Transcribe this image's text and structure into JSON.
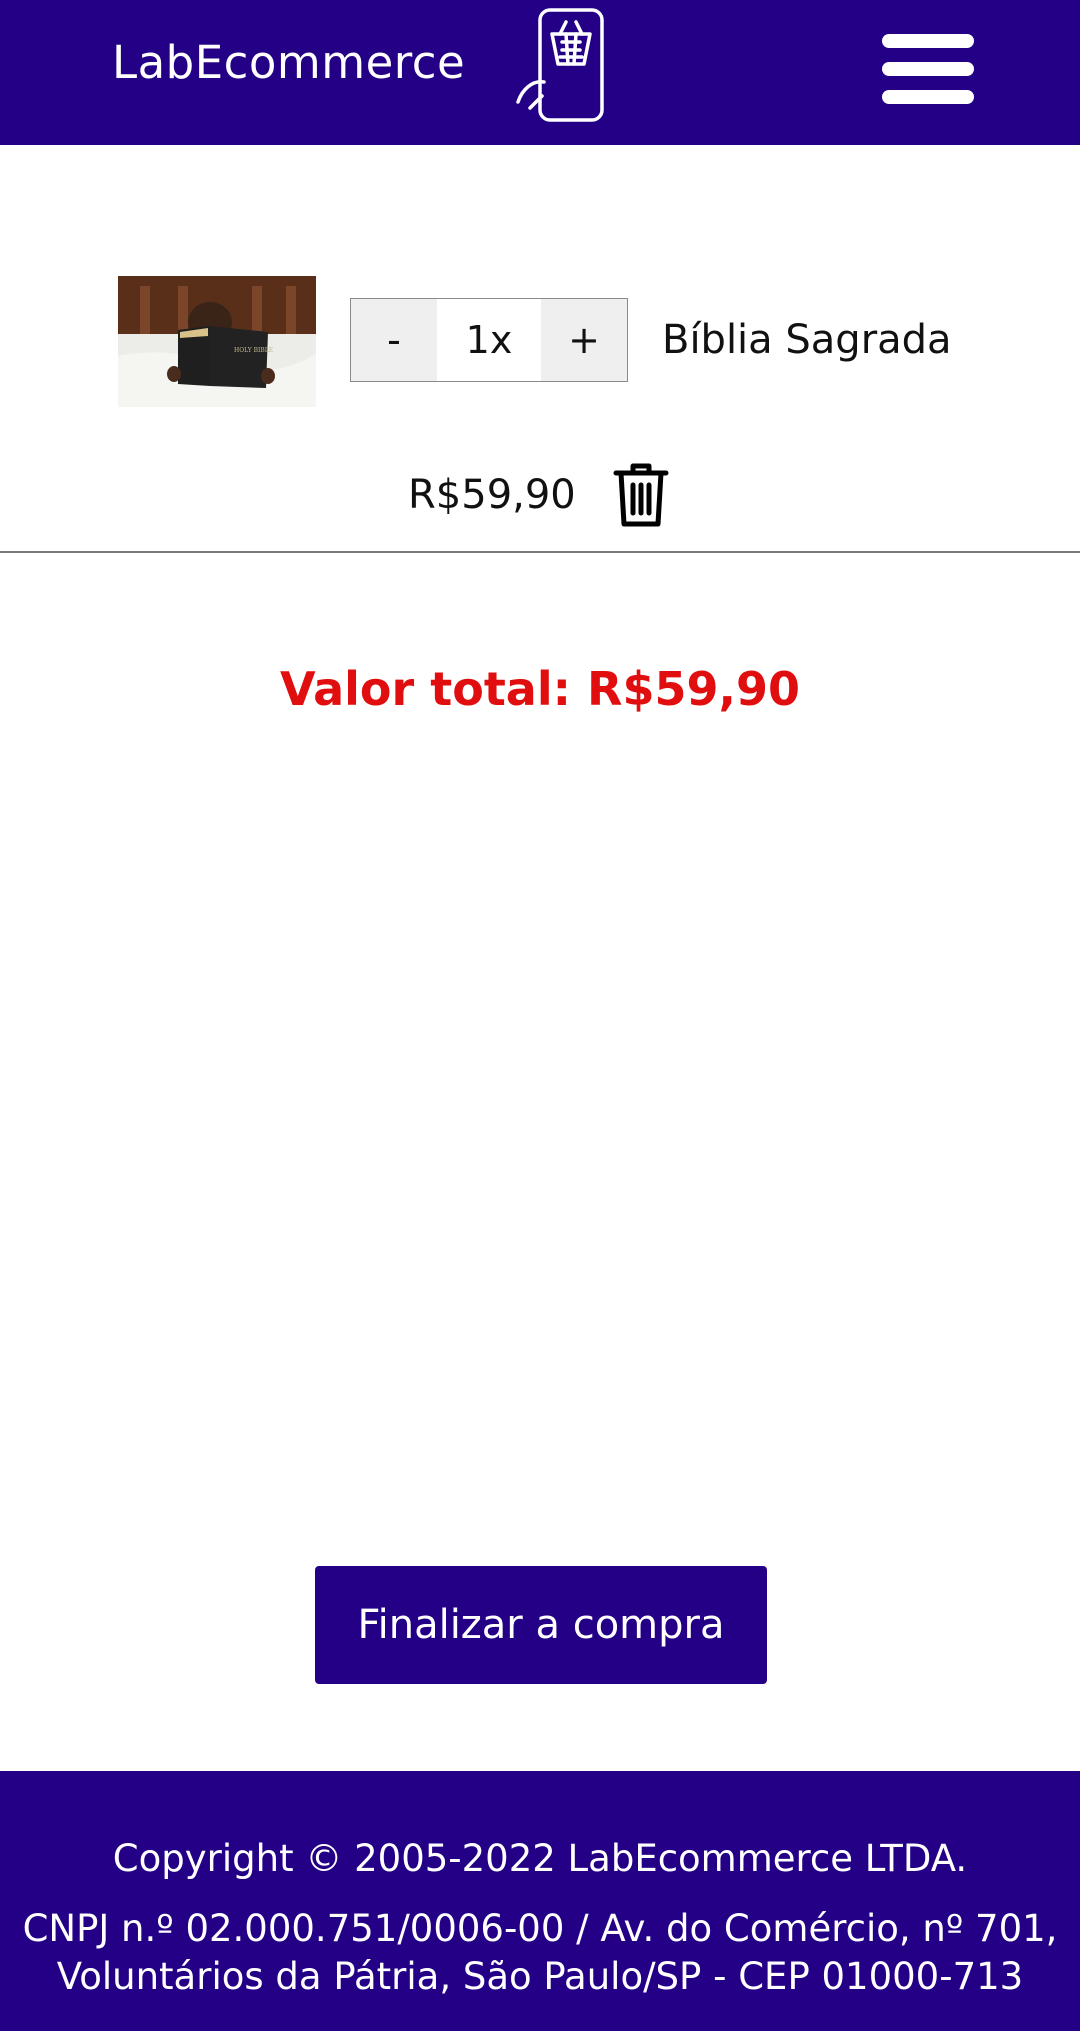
{
  "header": {
    "logo_text": "LabEcommerce",
    "logo_icon": "phone-basket-icon",
    "menu_icon": "hamburger-menu-icon"
  },
  "cart": {
    "items": [
      {
        "image": "child-reading-bible-photo",
        "image_book_text": "HOLY BIBLE",
        "decrement_label": "-",
        "quantity": "1x",
        "increment_label": "+",
        "name": "Bíblia Sagrada",
        "price": "R$59,90",
        "delete_icon": "trash-icon"
      }
    ],
    "total": "Valor total: R$59,90"
  },
  "checkout_button": "Finalizar a compra",
  "footer": {
    "copyright": "Copyright © 2005-2022 LabEcommerce LTDA.",
    "address": "CNPJ n.º 02.000.751/0006-00 / Av. do Comércio, nº 701, Voluntários da Pátria, São Paulo/SP - CEP 01000-713"
  },
  "colors": {
    "brand": "#230085",
    "total": "#e00e0e"
  }
}
